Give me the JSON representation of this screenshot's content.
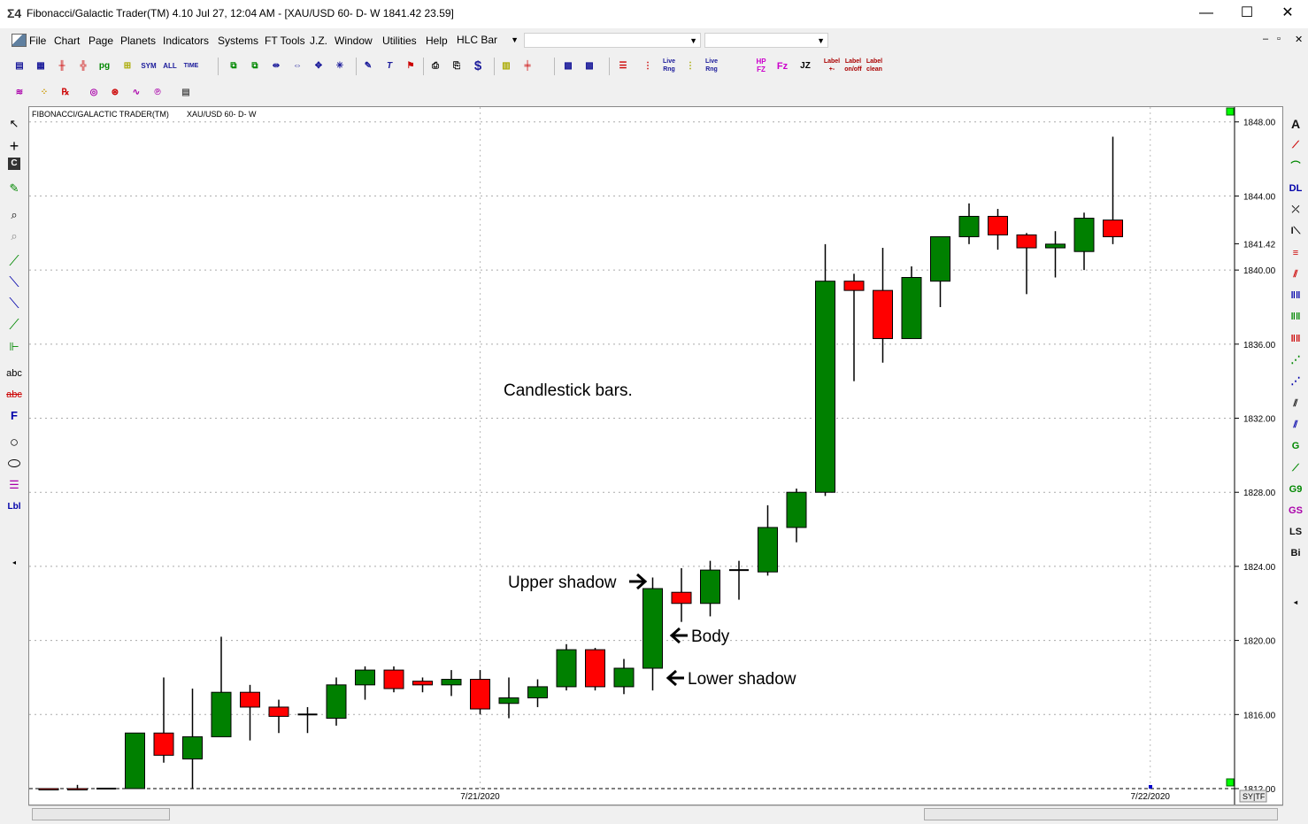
{
  "window": {
    "title": "Fibonacci/Galactic Trader(TM) 4.10 Jul 27,  12:04 AM - [XAU/USD 60- D- W 1841.42    23.59]",
    "app_icon": "Σ4",
    "minimize": "—",
    "maximize": "☐",
    "close": "✕"
  },
  "menubar": {
    "items": [
      "File",
      "Chart",
      "Page",
      "Planets",
      "Indicators",
      "Systems",
      "FT Tools",
      "J.Z.",
      "Window",
      "Utilities",
      "Help"
    ],
    "bar_type_value": "HLC Bar",
    "combo2_value": "",
    "combo3_value": "",
    "mdi_minimize": "–",
    "mdi_restore": "▫",
    "mdi_close": "✕"
  },
  "toolbar1": {
    "labels": [
      "SYM",
      "ALL",
      "TIME",
      "$",
      "Live Rng",
      "Live Rng",
      "HP FZ",
      "Fz",
      "JZ",
      "Label +-",
      "Label on/off",
      "Label clean"
    ]
  },
  "chart": {
    "header_left": "FIBONACCI/GALACTIC TRADER(TM)",
    "header_right": "XAU/USD 60- D- W",
    "annotations": {
      "title": "Candlestick bars.",
      "upper_shadow": "Upper shadow",
      "body": "Body",
      "lower_shadow": "Lower shadow"
    },
    "sytf": "SY|TF"
  },
  "chart_data": {
    "type": "candlestick",
    "y_axis_ticks": [
      "1848.00",
      "1844.00",
      "1841.42",
      "1840.00",
      "1836.00",
      "1832.00",
      "1828.00",
      "1824.00",
      "1820.00",
      "1816.00",
      "1812.00"
    ],
    "ylim": [
      1812,
      1848.8
    ],
    "last_price": 1841.42,
    "x_tick_labels": [
      "7/21/2020",
      "7/22/2020"
    ],
    "colors": {
      "up": "#008000",
      "down": "#ff0000",
      "wick": "#000000"
    },
    "candles": [
      {
        "o": 1812.0,
        "h": 1812.0,
        "l": 1811.0,
        "c": 1811.6
      },
      {
        "o": 1812.0,
        "h": 1812.2,
        "l": 1811.0,
        "c": 1811.4
      },
      {
        "o": 1811.6,
        "h": 1811.6,
        "l": 1811.6,
        "c": 1811.6
      },
      {
        "o": 1810.0,
        "h": 1815.0,
        "l": 1810.0,
        "c": 1815.0
      },
      {
        "o": 1815.0,
        "h": 1818.0,
        "l": 1813.4,
        "c": 1813.8
      },
      {
        "o": 1813.6,
        "h": 1817.4,
        "l": 1812.0,
        "c": 1814.8
      },
      {
        "o": 1814.8,
        "h": 1820.2,
        "l": 1814.8,
        "c": 1817.2
      },
      {
        "o": 1817.2,
        "h": 1817.6,
        "l": 1814.6,
        "c": 1816.4
      },
      {
        "o": 1816.4,
        "h": 1816.8,
        "l": 1815.0,
        "c": 1815.9
      },
      {
        "o": 1816.0,
        "h": 1816.4,
        "l": 1815.0,
        "c": 1816.0
      },
      {
        "o": 1815.8,
        "h": 1818.0,
        "l": 1815.4,
        "c": 1817.6
      },
      {
        "o": 1817.6,
        "h": 1818.6,
        "l": 1816.8,
        "c": 1818.4
      },
      {
        "o": 1818.4,
        "h": 1818.6,
        "l": 1817.2,
        "c": 1817.4
      },
      {
        "o": 1817.8,
        "h": 1818.0,
        "l": 1817.2,
        "c": 1817.6
      },
      {
        "o": 1817.6,
        "h": 1818.4,
        "l": 1817.0,
        "c": 1817.9
      },
      {
        "o": 1817.9,
        "h": 1818.4,
        "l": 1816.0,
        "c": 1816.3
      },
      {
        "o": 1816.6,
        "h": 1818.0,
        "l": 1815.8,
        "c": 1816.9
      },
      {
        "o": 1816.9,
        "h": 1817.9,
        "l": 1816.4,
        "c": 1817.5
      },
      {
        "o": 1817.5,
        "h": 1819.8,
        "l": 1817.3,
        "c": 1819.5
      },
      {
        "o": 1819.5,
        "h": 1819.6,
        "l": 1817.3,
        "c": 1817.5
      },
      {
        "o": 1817.5,
        "h": 1819.0,
        "l": 1817.1,
        "c": 1818.5
      },
      {
        "o": 1818.5,
        "h": 1823.4,
        "l": 1817.3,
        "c": 1822.8
      },
      {
        "o": 1822.6,
        "h": 1823.9,
        "l": 1821.0,
        "c": 1822.0
      },
      {
        "o": 1822.0,
        "h": 1824.3,
        "l": 1821.3,
        "c": 1823.8
      },
      {
        "o": 1823.8,
        "h": 1824.3,
        "l": 1822.2,
        "c": 1823.8
      },
      {
        "o": 1823.7,
        "h": 1827.3,
        "l": 1823.5,
        "c": 1826.1
      },
      {
        "o": 1826.1,
        "h": 1828.2,
        "l": 1825.3,
        "c": 1828.0
      },
      {
        "o": 1828.0,
        "h": 1841.4,
        "l": 1827.8,
        "c": 1839.4
      },
      {
        "o": 1839.4,
        "h": 1839.8,
        "l": 1834.0,
        "c": 1838.9
      },
      {
        "o": 1838.9,
        "h": 1841.2,
        "l": 1835.0,
        "c": 1836.3
      },
      {
        "o": 1836.3,
        "h": 1840.2,
        "l": 1836.3,
        "c": 1839.6
      },
      {
        "o": 1839.4,
        "h": 1841.8,
        "l": 1838.0,
        "c": 1841.8
      },
      {
        "o": 1841.8,
        "h": 1843.6,
        "l": 1841.4,
        "c": 1842.9
      },
      {
        "o": 1842.9,
        "h": 1843.3,
        "l": 1841.1,
        "c": 1841.9
      },
      {
        "o": 1841.9,
        "h": 1842.0,
        "l": 1838.7,
        "c": 1841.2
      },
      {
        "o": 1841.2,
        "h": 1842.1,
        "l": 1839.6,
        "c": 1841.4
      },
      {
        "o": 1841.0,
        "h": 1843.1,
        "l": 1840.0,
        "c": 1842.8
      },
      {
        "o": 1842.7,
        "h": 1847.2,
        "l": 1841.4,
        "c": 1841.8
      }
    ]
  }
}
